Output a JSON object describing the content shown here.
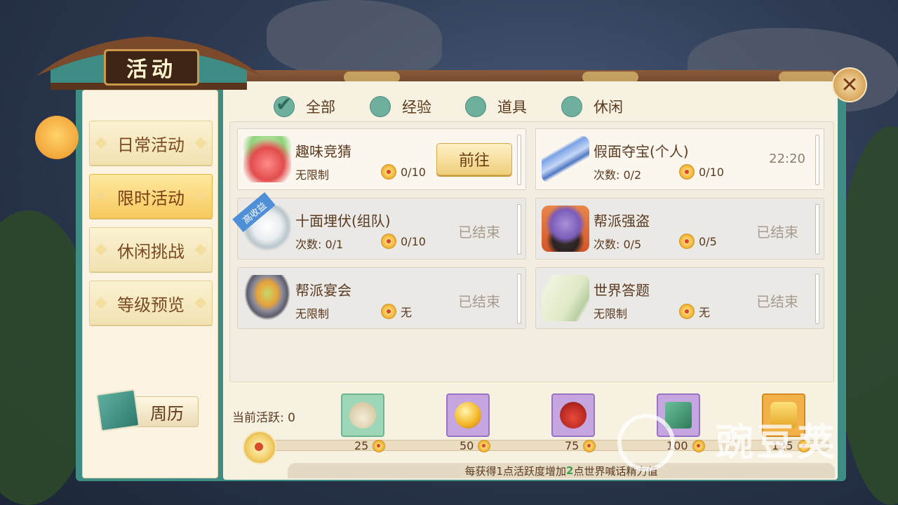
{
  "header": {
    "title": "活动"
  },
  "filters": [
    {
      "label": "全部",
      "checked": true
    },
    {
      "label": "经验",
      "checked": false
    },
    {
      "label": "道具",
      "checked": false
    },
    {
      "label": "休闲",
      "checked": false
    }
  ],
  "sidebar": {
    "tabs": [
      {
        "label": "日常活动",
        "active": false
      },
      {
        "label": "限时活动",
        "active": true
      },
      {
        "label": "休闲挑战",
        "active": false
      },
      {
        "label": "等级预览",
        "active": false
      }
    ],
    "calendar_label": "周历"
  },
  "activities": [
    {
      "name": "趣味竞猜",
      "limit": "无限制",
      "reward": "0/10",
      "action": "前往",
      "icon": "gift-icon"
    },
    {
      "name": "假面夺宝(个人)",
      "limit": "次数: 0/2",
      "reward": "0/10",
      "time": "22:20",
      "icon": "sword-icon"
    },
    {
      "name": "十面埋伏(组队)",
      "limit": "次数: 0/1",
      "reward": "0/10",
      "status": "已结束",
      "badge": "高收益",
      "icon": "moon-icon"
    },
    {
      "name": "帮派强盗",
      "limit": "次数: 0/5",
      "reward": "0/5",
      "status": "已结束",
      "icon": "bandit-icon"
    },
    {
      "name": "帮派宴会",
      "limit": "无限制",
      "reward": "无",
      "status": "已结束",
      "icon": "pot-icon"
    },
    {
      "name": "世界答题",
      "limit": "无限制",
      "reward": "无",
      "status": "已结束",
      "icon": "scroll-icon"
    }
  ],
  "activity_bar": {
    "label": "当前活跃: 0",
    "current": 0,
    "milestones": [
      "25",
      "50",
      "75",
      "100",
      "125"
    ],
    "note_prefix": "每获得1点活跃度增加",
    "note_num": "2",
    "note_suffix": "点世界喊话精力值"
  },
  "watermark": "豌豆荚",
  "colors": {
    "accent": "#3f8c84",
    "button": "#efcf7c",
    "ended": "#a69c8f"
  }
}
